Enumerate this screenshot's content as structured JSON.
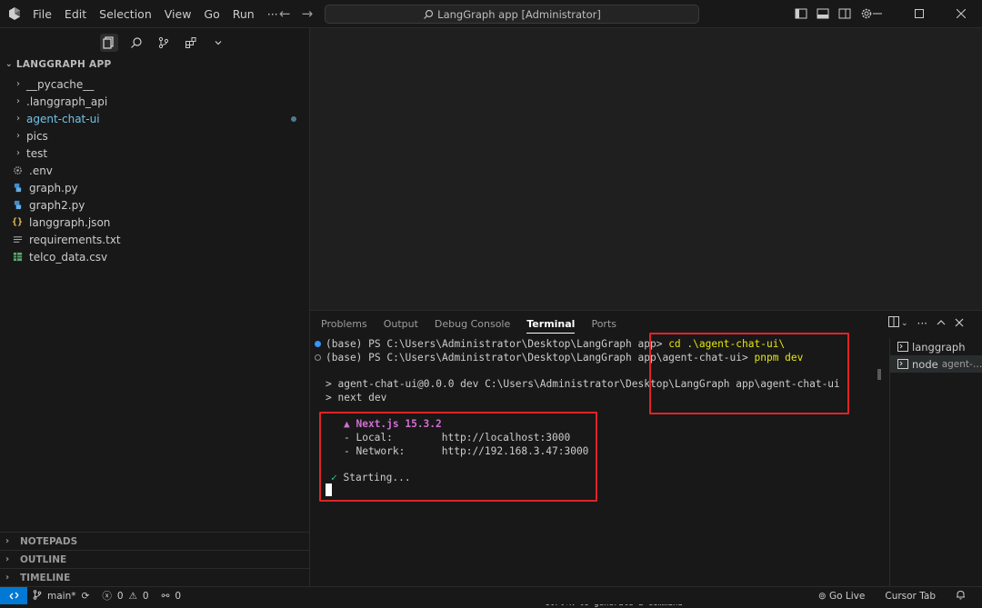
{
  "window": {
    "title": "LangGraph app [Administrator]"
  },
  "menu": [
    "File",
    "Edit",
    "Selection",
    "View",
    "Go",
    "Run",
    "···"
  ],
  "explorer": {
    "heading": "LANGGRAPH APP",
    "items": [
      {
        "label": "__pycache__",
        "type": "folder"
      },
      {
        "label": ".langgraph_api",
        "type": "folder"
      },
      {
        "label": "agent-chat-ui",
        "type": "folder",
        "modified": true
      },
      {
        "label": "pics",
        "type": "folder"
      },
      {
        "label": "test",
        "type": "folder"
      },
      {
        "label": ".env",
        "type": "gear"
      },
      {
        "label": "graph.py",
        "type": "python"
      },
      {
        "label": "graph2.py",
        "type": "python"
      },
      {
        "label": "langgraph.json",
        "type": "json"
      },
      {
        "label": "requirements.txt",
        "type": "text"
      },
      {
        "label": "telco_data.csv",
        "type": "csv"
      }
    ],
    "sections": [
      "NOTEPADS",
      "OUTLINE",
      "TIMELINE"
    ]
  },
  "panel": {
    "tabs": [
      "Problems",
      "Output",
      "Debug Console",
      "Terminal",
      "Ports"
    ],
    "active_tab": "Terminal",
    "terminal": {
      "line1_prompt": "(base) PS C:\\Users\\Administrator\\Desktop\\LangGraph app> ",
      "line1_cmd": "cd .\\agent-chat-ui\\",
      "line2_prompt": "(base) PS C:\\Users\\Administrator\\Desktop\\LangGraph app\\agent-chat-ui> ",
      "line2_cmd": "pnpm dev",
      "line3": "> agent-chat-ui@0.0.0 dev C:\\Users\\Administrator\\Desktop\\LangGraph app\\agent-chat-ui",
      "line4": "> next dev",
      "nextjs": "▲ Next.js 15.3.2",
      "local": "- Local:        http://localhost:3000",
      "network": "- Network:      http://192.168.3.47:3000",
      "check": "✓",
      "starting": "Starting..."
    },
    "hint": "Ctrl+K to generate a command",
    "terminal_list": [
      {
        "label": "langgraph",
        "sub": ""
      },
      {
        "label": "node",
        "sub": "agent-…"
      }
    ],
    "highlight_color": "#e02424"
  },
  "statusbar": {
    "branch": "main*",
    "errors": "0",
    "warnings": "0",
    "ports": "0",
    "golive": "Go Live",
    "cursortab": "Cursor Tab"
  }
}
